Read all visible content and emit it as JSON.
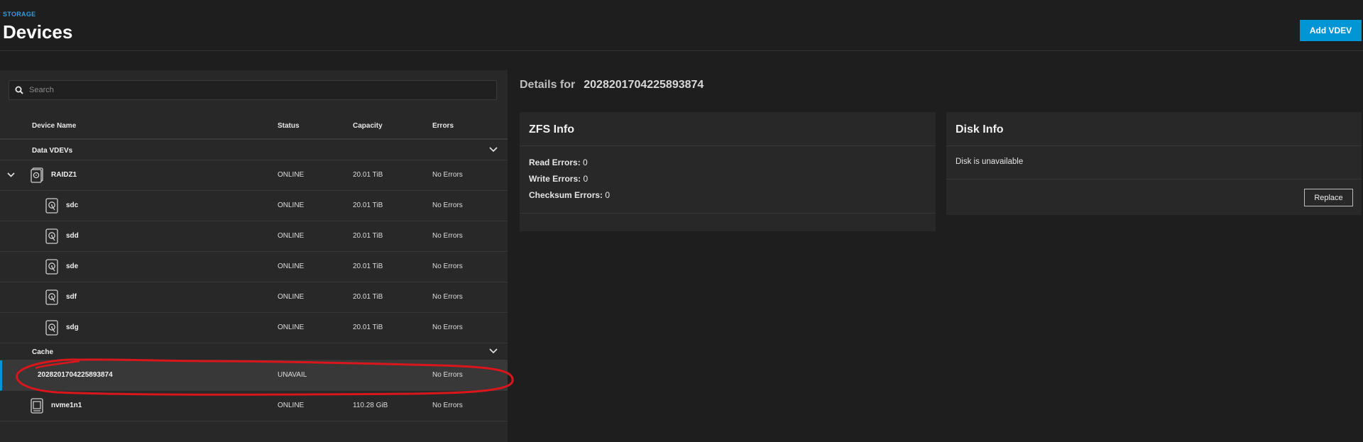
{
  "header": {
    "breadcrumb": "STORAGE",
    "title": "Devices",
    "add_vdev_label": "Add VDEV"
  },
  "search": {
    "placeholder": "Search"
  },
  "table": {
    "columns": [
      "Device Name",
      "Status",
      "Capacity",
      "Errors"
    ]
  },
  "groups": {
    "data_vdevs": "Data VDEVs",
    "cache": "Cache"
  },
  "rows": [
    {
      "name": "RAIDZ1",
      "status": "ONLINE",
      "capacity": "20.01 TiB",
      "errors": "No Errors"
    },
    {
      "name": "sdc",
      "status": "ONLINE",
      "capacity": "20.01 TiB",
      "errors": "No Errors"
    },
    {
      "name": "sdd",
      "status": "ONLINE",
      "capacity": "20.01 TiB",
      "errors": "No Errors"
    },
    {
      "name": "sde",
      "status": "ONLINE",
      "capacity": "20.01 TiB",
      "errors": "No Errors"
    },
    {
      "name": "sdf",
      "status": "ONLINE",
      "capacity": "20.01 TiB",
      "errors": "No Errors"
    },
    {
      "name": "sdg",
      "status": "ONLINE",
      "capacity": "20.01 TiB",
      "errors": "No Errors"
    }
  ],
  "cache_rows": [
    {
      "name": "2028201704225893874",
      "status": "UNAVAIL",
      "capacity": "",
      "errors": "No Errors"
    },
    {
      "name": "nvme1n1",
      "status": "ONLINE",
      "capacity": "110.28 GiB",
      "errors": "No Errors"
    }
  ],
  "details": {
    "label": "Details for",
    "device": "2028201704225893874"
  },
  "zfs_info": {
    "title": "ZFS Info",
    "read_label": "Read Errors:",
    "read_value": "0",
    "write_label": "Write Errors:",
    "write_value": "0",
    "checksum_label": "Checksum Errors:",
    "checksum_value": "0"
  },
  "disk_info": {
    "title": "Disk Info",
    "message": "Disk is unavailable",
    "replace_label": "Replace"
  },
  "colors": {
    "accent": "#0095d5",
    "annotation": "#d9161c"
  }
}
